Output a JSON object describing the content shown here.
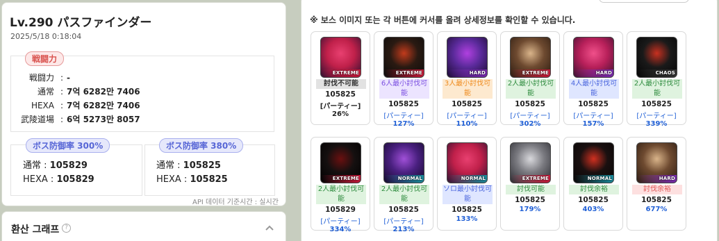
{
  "character": {
    "title": "Lv.290 パスファインダー",
    "date": "2025/5/18 0:18:04"
  },
  "power": {
    "label": "戦闘力",
    "rows": [
      {
        "key": "戦闘力",
        "value": "-"
      },
      {
        "key": "通常",
        "value": "7억 6282만 7406"
      },
      {
        "key": "HEXA",
        "value": "7억 6282만 7406"
      },
      {
        "key": "武陵道場",
        "value": "6억 5273만 8057"
      }
    ]
  },
  "defense": [
    {
      "label": "ボス防御率 300%",
      "normal_key": "通常 :",
      "normal_val": "105829",
      "hexa_key": "HEXA :",
      "hexa_val": "105829"
    },
    {
      "label": "ボス防御率 380%",
      "normal_key": "通常 :",
      "normal_val": "105825",
      "hexa_key": "HEXA :",
      "hexa_val": "105825"
    }
  ],
  "api_note": "API 데이터 기준시간 : 실시간",
  "graph": {
    "title": "환산 그래프",
    "help": "?"
  },
  "hint": "※ 보스 이미지 또는 각 버튼에 커서를 올려 상세정보를 확인할 수 있습니다.",
  "colors": {
    "accent_red": "#d9534f",
    "accent_blue": "#5766d6",
    "link_blue": "#1f5fd6"
  },
  "bosses": [
    {
      "tag": "EXTREME",
      "status": "討伐不可能",
      "style": "gray",
      "num": "105825",
      "sub": "[パーティー]",
      "pct": "26%",
      "dark": true,
      "palette": [
        "#c0204a",
        "#e84070",
        "#2a1030"
      ]
    },
    {
      "tag": "EXTREME",
      "status": "6人最小討伐可能",
      "style": "purple",
      "num": "105825",
      "sub": "[パーティー]",
      "pct": "127%",
      "dark": false,
      "palette": [
        "#2a1a12",
        "#c23b1c",
        "#0b0b0b"
      ]
    },
    {
      "tag": "HARD",
      "status": "3人最小討伐可能",
      "style": "orange",
      "num": "105825",
      "sub": "[パーティー]",
      "pct": "110%",
      "dark": false,
      "palette": [
        "#5a2a9a",
        "#b040e0",
        "#1a0a30"
      ]
    },
    {
      "tag": "EXTREME",
      "status": "2人最小討伐可能",
      "style": "green",
      "num": "105825",
      "sub": "[パーティー]",
      "pct": "302%",
      "dark": false,
      "palette": [
        "#6e4a30",
        "#d9b48a",
        "#2a1a10"
      ]
    },
    {
      "tag": "HARD",
      "status": "4人最小討伐可能",
      "style": "blue",
      "num": "105825",
      "sub": "[パーティー]",
      "pct": "157%",
      "dark": false,
      "palette": [
        "#b8205a",
        "#f0508a",
        "#3a1030"
      ]
    },
    {
      "tag": "CHAOS",
      "status": "2人最小討伐可能",
      "style": "green",
      "num": "105825",
      "sub": "[パーティー]",
      "pct": "339%",
      "dark": false,
      "palette": [
        "#1a1a1a",
        "#c83020",
        "#050505"
      ]
    },
    {
      "tag": "EXTREME",
      "status": "2人最小討伐可能",
      "style": "green",
      "num": "105829",
      "sub": "[パーティー]",
      "pct": "334%",
      "dark": false,
      "palette": [
        "#151010",
        "#6a1010",
        "#000000"
      ]
    },
    {
      "tag": "NORMAL",
      "status": "2人最小討伐可能",
      "style": "green",
      "num": "105825",
      "sub": "[パーティー]",
      "pct": "213%",
      "dark": false,
      "palette": [
        "#4a2080",
        "#a050d8",
        "#120828"
      ]
    },
    {
      "tag": "NORMAL",
      "status": "ソロ最小討伐可能",
      "style": "blue",
      "num": "105825",
      "sub": "",
      "pct": "133%",
      "dark": false,
      "palette": [
        "#c0204a",
        "#e84070",
        "#2a1030"
      ]
    },
    {
      "tag": "EXTREME",
      "status": "討伐可能",
      "style": "green",
      "num": "105825",
      "sub": "",
      "pct": "179%",
      "dark": false,
      "palette": [
        "#7a7a80",
        "#d8d8dc",
        "#2a2a30"
      ]
    },
    {
      "tag": "NORMAL",
      "status": "討伐余裕",
      "style": "green",
      "num": "105825",
      "sub": "",
      "pct": "403%",
      "dark": false,
      "palette": [
        "#1a1010",
        "#d03020",
        "#070505"
      ]
    },
    {
      "tag": "HARD",
      "status": "討伐余裕",
      "style": "pink",
      "num": "105825",
      "sub": "",
      "pct": "677%",
      "dark": false,
      "palette": [
        "#6e4a30",
        "#d9b48a",
        "#2a1a10"
      ]
    }
  ]
}
